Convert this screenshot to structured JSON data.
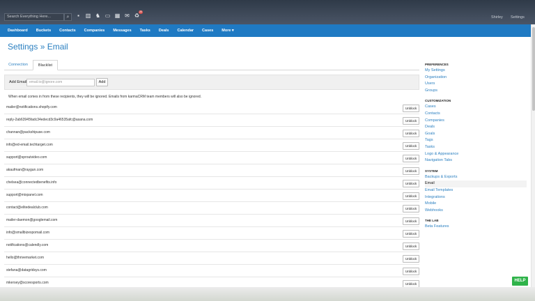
{
  "header": {
    "search_placeholder": "Search Everything Here...",
    "user": "Shirley",
    "settings": "Settings",
    "notification_count": "20"
  },
  "nav": [
    "Dashboard",
    "Buckets",
    "Contacts",
    "Companies",
    "Messages",
    "Tasks",
    "Deals",
    "Calendar",
    "Cases",
    "More ▾"
  ],
  "page": {
    "title": "Settings » Email"
  },
  "tabs": [
    "Connection",
    "Blacklist"
  ],
  "add_email": {
    "label": "Add Email",
    "placeholder": "email.to@ignore.com",
    "button": "Add"
  },
  "note": "When email comes in from these recipients, they will be ignored. Emails from karmaCRM team members will also be ignored.",
  "blacklist": [
    "mailer@notifications.shopify.com",
    "reply-2ab63945fadc34edecd3c9a46535afc@asana.com",
    "channan@packshipuse.com",
    "info@ed-email.techtarget.com",
    "support@sproutvideo.com",
    "akaufman@raygun.com",
    "chelsea@connectedbenefits.info",
    "support@mixpanel.com",
    "contact@elitedealclub.com",
    "mailer-daemon@googlemail.com",
    "info@smallbizexpomail.com",
    "notifications@calendly.com",
    "hello@thrivemarket.com",
    "stefana@datagridsys.com",
    "mkersey@scoresports.com"
  ],
  "unblock_label": "Unblock",
  "sidebar": {
    "preferences_title": "PREFERENCES",
    "preferences": [
      "My Settings",
      "Organization",
      "Users",
      "Groups"
    ],
    "customization_title": "CUSTOMIZATION",
    "customization": [
      "Cases",
      "Contacts",
      "Companies",
      "Deals",
      "Goals",
      "Tags",
      "Tasks",
      "Logo & Appearance",
      "Navigation Tabs"
    ],
    "system_title": "SYSTEM",
    "system": [
      "Backups & Exports",
      "Email",
      "Email Templates",
      "Integrations",
      "Mobile",
      "Webhooks"
    ],
    "lab_title": "THE LAB",
    "lab": [
      "Beta Features"
    ]
  },
  "help": "HELP"
}
